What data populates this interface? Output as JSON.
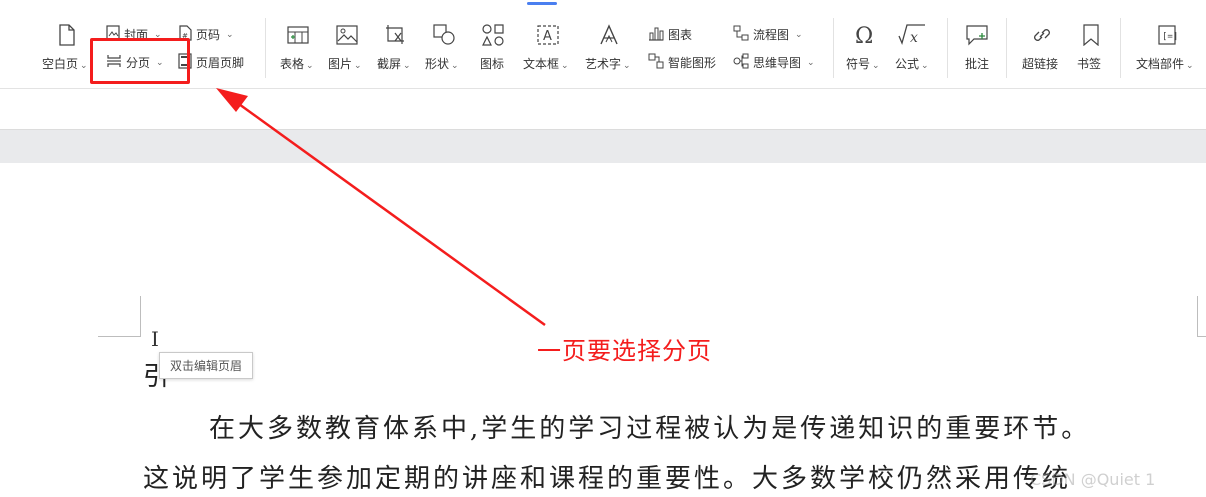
{
  "ribbon": {
    "blank_page": "空白页",
    "cover": "封面",
    "page_break": "分页",
    "page_number": "页码",
    "header_footer": "页眉页脚",
    "table": "表格",
    "picture": "图片",
    "screenshot": "截屏",
    "shape": "形状",
    "icons": "图标",
    "textbox": "文本框",
    "wordart": "艺术字",
    "chart": "图表",
    "smart_shape": "智能图形",
    "flowchart": "流程图",
    "mindmap": "思维导图",
    "symbol": "符号",
    "formula": "公式",
    "comment": "批注",
    "hyperlink": "超链接",
    "bookmark": "书签",
    "doc_parts": "文档部件"
  },
  "annotation": {
    "text": "一页要选择分页",
    "color": "#f41d1d"
  },
  "document": {
    "tooltip": "双击编辑页眉",
    "intro_partial": "引",
    "para1": "在大多数教育体系中,学生的学习过程被认为是传递知识的重要环节。",
    "para2": "这说明了学生参加定期的讲座和课程的重要性。大多数学校仍然采用传统"
  },
  "watermark": "CSDN @Quiet 1"
}
